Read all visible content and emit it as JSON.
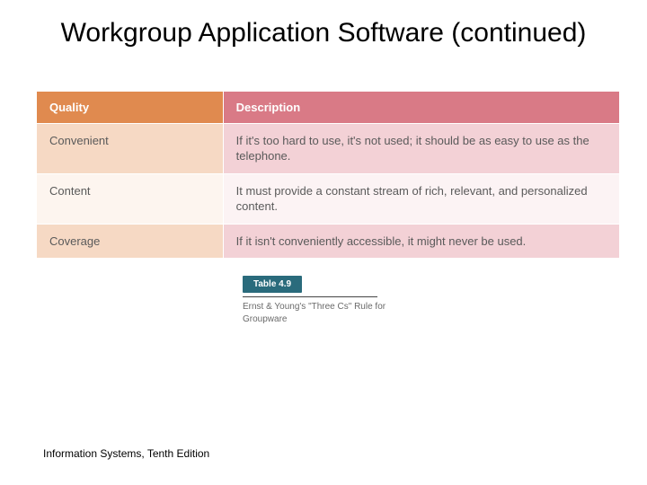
{
  "title": "Workgroup Application Software (continued)",
  "table": {
    "headers": {
      "quality": "Quality",
      "description": "Description"
    },
    "rows": [
      {
        "quality": "Convenient",
        "description": "If it's too hard to use, it's not used; it should be as easy to use as the telephone."
      },
      {
        "quality": "Content",
        "description": "It must provide a constant stream of rich, relevant, and personalized content."
      },
      {
        "quality": "Coverage",
        "description": "If it isn't conveniently accessible, it might never be used."
      }
    ]
  },
  "caption": {
    "badge": "Table 4.9",
    "text": "Ernst & Young's \"Three Cs\" Rule for Groupware"
  },
  "footer": "Information Systems, Tenth Edition"
}
